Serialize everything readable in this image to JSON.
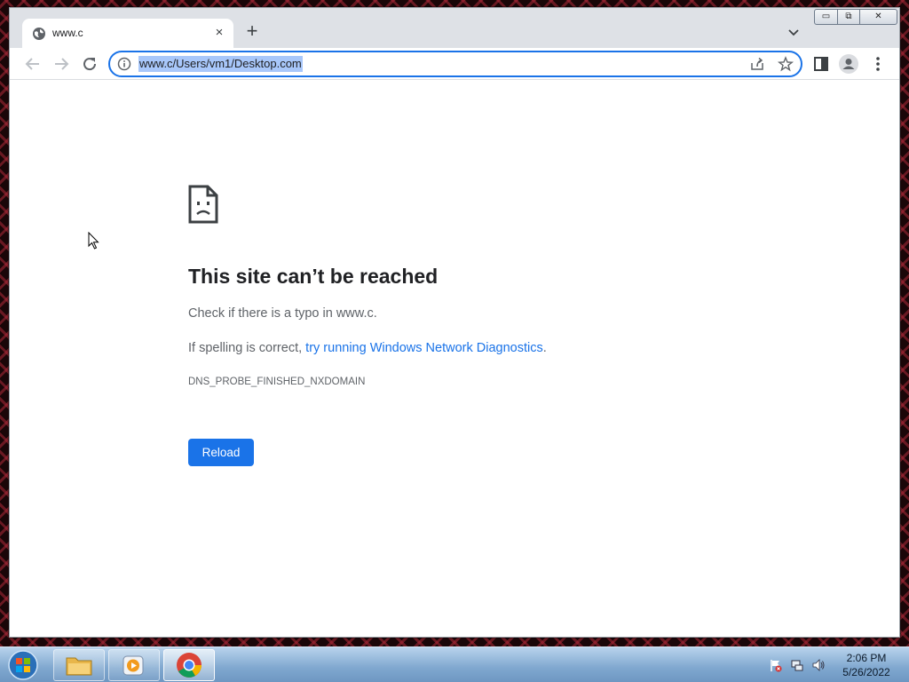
{
  "browser": {
    "tab": {
      "title": "www.c",
      "close_label": "×"
    },
    "new_tab_label": "+",
    "window_controls": {
      "minimize": "▭",
      "maximize": "⧉",
      "close": "✕"
    },
    "address_bar": {
      "url": "www.c/Users/vm1/Desktop.com"
    }
  },
  "error_page": {
    "title": "This site can’t be reached",
    "line1": "Check if there is a typo in www.c.",
    "line2_prefix": "If spelling is correct, ",
    "line2_link": "try running Windows Network Diagnostics",
    "line2_suffix": ".",
    "error_code": "DNS_PROBE_FINISHED_NXDOMAIN",
    "reload_label": "Reload"
  },
  "taskbar": {
    "apps": [
      "file-explorer",
      "media-player",
      "chrome"
    ],
    "clock": {
      "time": "2:06 PM",
      "date": "5/26/2022"
    }
  },
  "colors": {
    "accent": "#1a73e8",
    "link": "#1a73e8",
    "url_highlight": "#a8c7fa"
  }
}
